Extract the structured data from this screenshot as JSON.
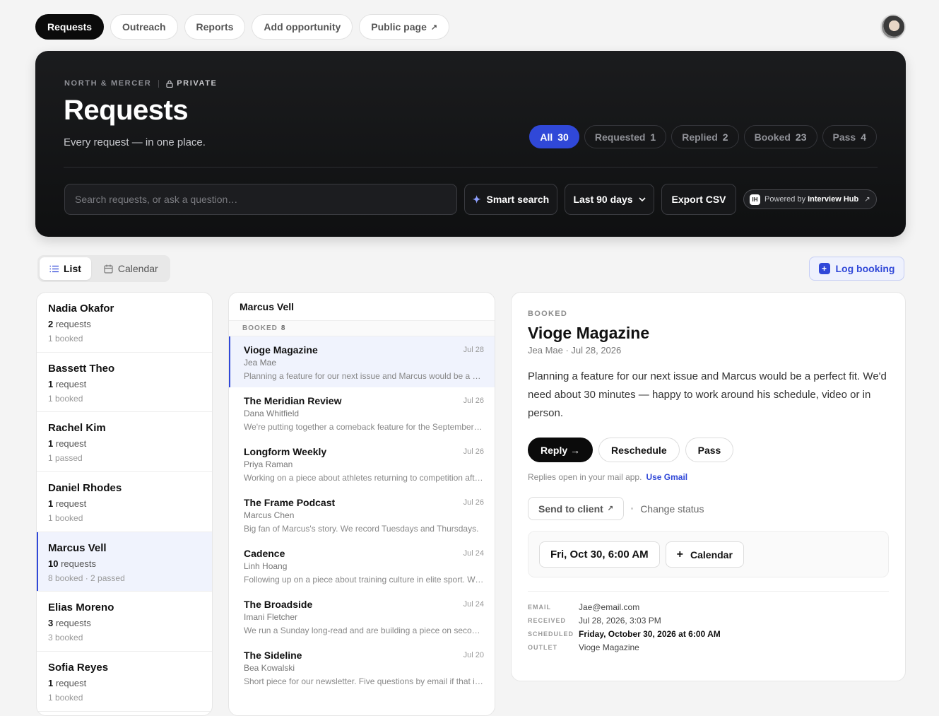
{
  "nav": {
    "tabs": [
      {
        "label": "Requests"
      },
      {
        "label": "Outreach"
      },
      {
        "label": "Reports"
      },
      {
        "label": "Add opportunity"
      },
      {
        "label": "Public page",
        "icon": "external-link-icon"
      }
    ]
  },
  "hero": {
    "org": "NORTH & MERCER",
    "privacy": "PRIVATE",
    "title": "Requests",
    "subtitle": "Every request — in one place.",
    "filters": [
      {
        "label": "All",
        "count": "30"
      },
      {
        "label": "Requested",
        "count": "1"
      },
      {
        "label": "Replied",
        "count": "2"
      },
      {
        "label": "Booked",
        "count": "23"
      },
      {
        "label": "Pass",
        "count": "4"
      }
    ],
    "search_placeholder": "Search requests, or ask a question…",
    "smart_search": "Smart search",
    "range": "Last 90 days",
    "export": "Export CSV",
    "powered_prefix": "Powered by",
    "powered_brand": "Interview Hub",
    "powered_logo": "IH"
  },
  "view": {
    "list": "List",
    "calendar": "Calendar",
    "log_booking": "Log booking"
  },
  "people": [
    {
      "name": "Nadia Okafor",
      "count": "2",
      "unit": "requests",
      "status": "1 booked"
    },
    {
      "name": "Bassett Theo",
      "count": "1",
      "unit": "request",
      "status": "1 booked"
    },
    {
      "name": "Rachel Kim",
      "count": "1",
      "unit": "request",
      "status": "1 passed"
    },
    {
      "name": "Daniel Rhodes",
      "count": "1",
      "unit": "request",
      "status": "1 booked"
    },
    {
      "name": "Marcus Vell",
      "count": "10",
      "unit": "requests",
      "status": "8 booked · 2 passed"
    },
    {
      "name": "Elias Moreno",
      "count": "3",
      "unit": "requests",
      "status": "3 booked"
    },
    {
      "name": "Sofia Reyes",
      "count": "1",
      "unit": "request",
      "status": "1 booked"
    }
  ],
  "middle": {
    "person": "Marcus Vell",
    "group_label": "BOOKED",
    "group_count": "8",
    "requests": [
      {
        "title": "Vioge Magazine",
        "date": "Jul 28",
        "author": "Jea Mae",
        "preview": "Planning a feature for our next issue and Marcus would be a perfect fit."
      },
      {
        "title": "The Meridian Review",
        "date": "Jul 26",
        "author": "Dana Whitfield",
        "preview": "We're putting together a comeback feature for the September issue."
      },
      {
        "title": "Longform Weekly",
        "date": "Jul 26",
        "author": "Priya Raman",
        "preview": "Working on a piece about athletes returning to competition after injury."
      },
      {
        "title": "The Frame Podcast",
        "date": "Jul 26",
        "author": "Marcus Chen",
        "preview": "Big fan of Marcus's story. We record Tuesdays and Thursdays."
      },
      {
        "title": "Cadence",
        "date": "Jul 24",
        "author": "Linh Hoang",
        "preview": "Following up on a piece about training culture in elite sport. Would love to chat."
      },
      {
        "title": "The Broadside",
        "date": "Jul 24",
        "author": "Imani Fletcher",
        "preview": "We run a Sunday long-read and are building a piece on second acts."
      },
      {
        "title": "The Sideline",
        "date": "Jul 20",
        "author": "Bea Kowalski",
        "preview": "Short piece for our newsletter. Five questions by email if that is easier."
      }
    ]
  },
  "detail": {
    "status": "BOOKED",
    "title": "Vioge Magazine",
    "meta": "Jea Mae · Jul 28, 2026",
    "body": "Planning a feature for our next issue and Marcus would be a perfect fit. We'd need about 30 minutes — happy to work around his schedule, video or in person.",
    "reply": "Reply →",
    "reschedule": "Reschedule",
    "pass": "Pass",
    "note": "Replies open in your mail app.",
    "use_gmail": "Use Gmail",
    "send_to_client": "Send to client",
    "change_status": "Change status",
    "scheduled_short": "Fri, Oct 30, 6:00 AM",
    "calendar": "Calendar",
    "fields": [
      {
        "key": "EMAIL",
        "value": "Jae@email.com"
      },
      {
        "key": "RECEIVED",
        "value": "Jul 28, 2026, 3:03 PM"
      },
      {
        "key": "SCHEDULED",
        "value": "Friday, October 30, 2026 at 6:00 AM"
      },
      {
        "key": "OUTLET",
        "value": "Vioge Magazine"
      }
    ]
  },
  "colors": {
    "accent": "#3048d8",
    "hero_bg": "#141517",
    "selected_bg": "#f0f3fd"
  }
}
